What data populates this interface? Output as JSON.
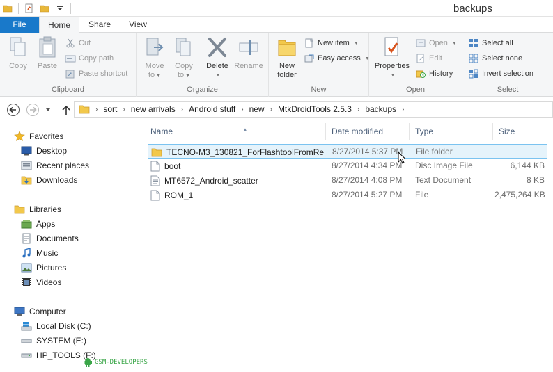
{
  "window": {
    "title": "backups"
  },
  "tabs": {
    "file": "File",
    "home": "Home",
    "share": "Share",
    "view": "View"
  },
  "ribbon": {
    "clipboard": {
      "label": "Clipboard",
      "copy": "Copy",
      "paste": "Paste",
      "cut": "Cut",
      "copy_path": "Copy path",
      "paste_shortcut": "Paste shortcut"
    },
    "organize": {
      "label": "Organize",
      "move_to_1": "Move",
      "move_to_2": "to",
      "copy_to_1": "Copy",
      "copy_to_2": "to",
      "delete": "Delete",
      "rename": "Rename"
    },
    "new": {
      "label": "New",
      "new_folder_1": "New",
      "new_folder_2": "folder",
      "new_item": "New item",
      "easy_access": "Easy access"
    },
    "open": {
      "label": "Open",
      "properties": "Properties",
      "open": "Open",
      "edit": "Edit",
      "history": "History"
    },
    "select": {
      "label": "Select",
      "select_all": "Select all",
      "select_none": "Select none",
      "invert_selection": "Invert selection"
    }
  },
  "address": {
    "crumbs": [
      "sort",
      "new arrivals",
      "Android stuff",
      "new",
      "MtkDroidTools 2.5.3",
      "backups"
    ]
  },
  "nav": {
    "favorites": "Favorites",
    "desktop": "Desktop",
    "recent_places": "Recent places",
    "downloads": "Downloads",
    "libraries": "Libraries",
    "apps": "Apps",
    "documents": "Documents",
    "music": "Music",
    "pictures": "Pictures",
    "videos": "Videos",
    "computer": "Computer",
    "local_disk": "Local Disk (C:)",
    "system": "SYSTEM (E:)",
    "hp_tools": "HP_TOOLS (F:)"
  },
  "columns": {
    "name": "Name",
    "date": "Date modified",
    "type": "Type",
    "size": "Size"
  },
  "files": [
    {
      "name": "TECNO-M3_130821_ForFlashtoolFromRe...",
      "date": "8/27/2014 5:37 PM",
      "type": "File folder",
      "size": "",
      "icon": "folder-icon"
    },
    {
      "name": "boot",
      "date": "8/27/2014 4:34 PM",
      "type": "Disc Image File",
      "size": "6,144 KB",
      "icon": "disc-image-icon"
    },
    {
      "name": "MT6572_Android_scatter",
      "date": "8/27/2014 4:08 PM",
      "type": "Text Document",
      "size": "8 KB",
      "icon": "text-document-icon"
    },
    {
      "name": "ROM_1",
      "date": "8/27/2014 5:27 PM",
      "type": "File",
      "size": "2,475,264 KB",
      "icon": "file-icon"
    }
  ],
  "watermark": "GSM-DEVELOPERS",
  "colors": {
    "accent": "#1979ca",
    "selection_bg": "#e5f3fb",
    "selection_border": "#7bc3f0"
  }
}
